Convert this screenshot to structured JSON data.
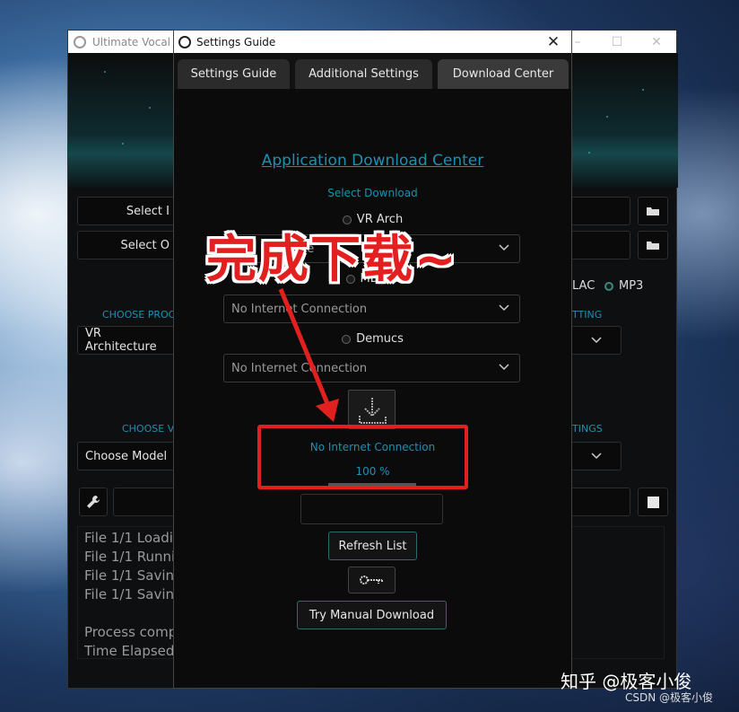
{
  "main_window": {
    "title": "Ultimate Vocal R",
    "select_input_label": "Select I",
    "select_output_label": "Select O",
    "format_lac": "LAC",
    "format_mp3": "MP3",
    "choose_process_label": "CHOOSE PROC",
    "process_value": "VR Architecture",
    "settings_label_1": "TTING",
    "choose_model_label": "CHOOSE V",
    "model_value": "Choose Model",
    "settings_label_2": "TINGS",
    "log_lines": [
      "File 1/1 Loadin",
      "File 1/1 Runnir",
      "File 1/1 Saving",
      "File 1/1 Saving",
      "",
      "Process comp",
      "Time Elapsed"
    ]
  },
  "settings_window": {
    "title": "Settings Guide",
    "tabs": [
      {
        "label": "Settings Guide"
      },
      {
        "label": "Additional Settings"
      },
      {
        "label": "Download Center"
      }
    ],
    "heading": "Application Download Center",
    "select_download": "Select Download",
    "radio_vr": "VR Arch",
    "radio_mdx": "MDX-N",
    "radio_demucs": "Demucs",
    "combo_vr": "ne",
    "combo_mdx": "No Internet Connection",
    "combo_demucs": "No Internet Connection",
    "status": "No Internet Connection",
    "progress": "100 %",
    "progress_value": 1.0,
    "refresh_button": "Refresh List",
    "manual_download_button": "Try Manual Download"
  },
  "annotation": {
    "text": "完成下载~",
    "color": "#e32020"
  },
  "watermarks": {
    "zhihu": "知乎 @极客小俊",
    "csdn": "CSDN @极客小俊"
  }
}
